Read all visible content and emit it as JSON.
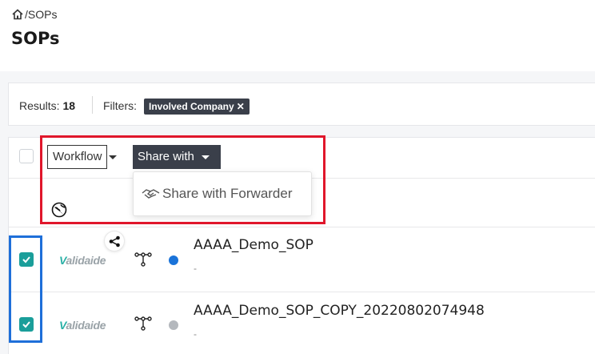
{
  "breadcrumb": {
    "path": "/SOPs"
  },
  "page": {
    "title": "SOPs"
  },
  "results": {
    "label": "Results:",
    "count": "18",
    "filters_label": "Filters:",
    "filter_chip": "Involved Company",
    "filter_remove": "✕"
  },
  "toolbar": {
    "workflow_label": "Workflow",
    "share_label": "Share with",
    "menu_item": "Share with Forwarder"
  },
  "rows": [
    {
      "name": "AAAA_Demo_SOP",
      "sub": "-",
      "logo": "Validaide",
      "checked": true,
      "status_color": "#1a73d9"
    },
    {
      "name": "AAAA_Demo_SOP_COPY_20220802074948",
      "sub": "-",
      "logo": "Validaide",
      "checked": true,
      "status_color": "#b4b8bd"
    }
  ],
  "colors": {
    "accent": "#1a9e9a",
    "dark_button": "#3a3f4a",
    "highlight_red": "#e0162b",
    "highlight_blue": "#1e6fd9"
  },
  "icons": [
    "home-icon",
    "caret-down-icon",
    "handshake-icon",
    "globe-icon",
    "share-icon",
    "workflow-icon",
    "check-icon"
  ]
}
